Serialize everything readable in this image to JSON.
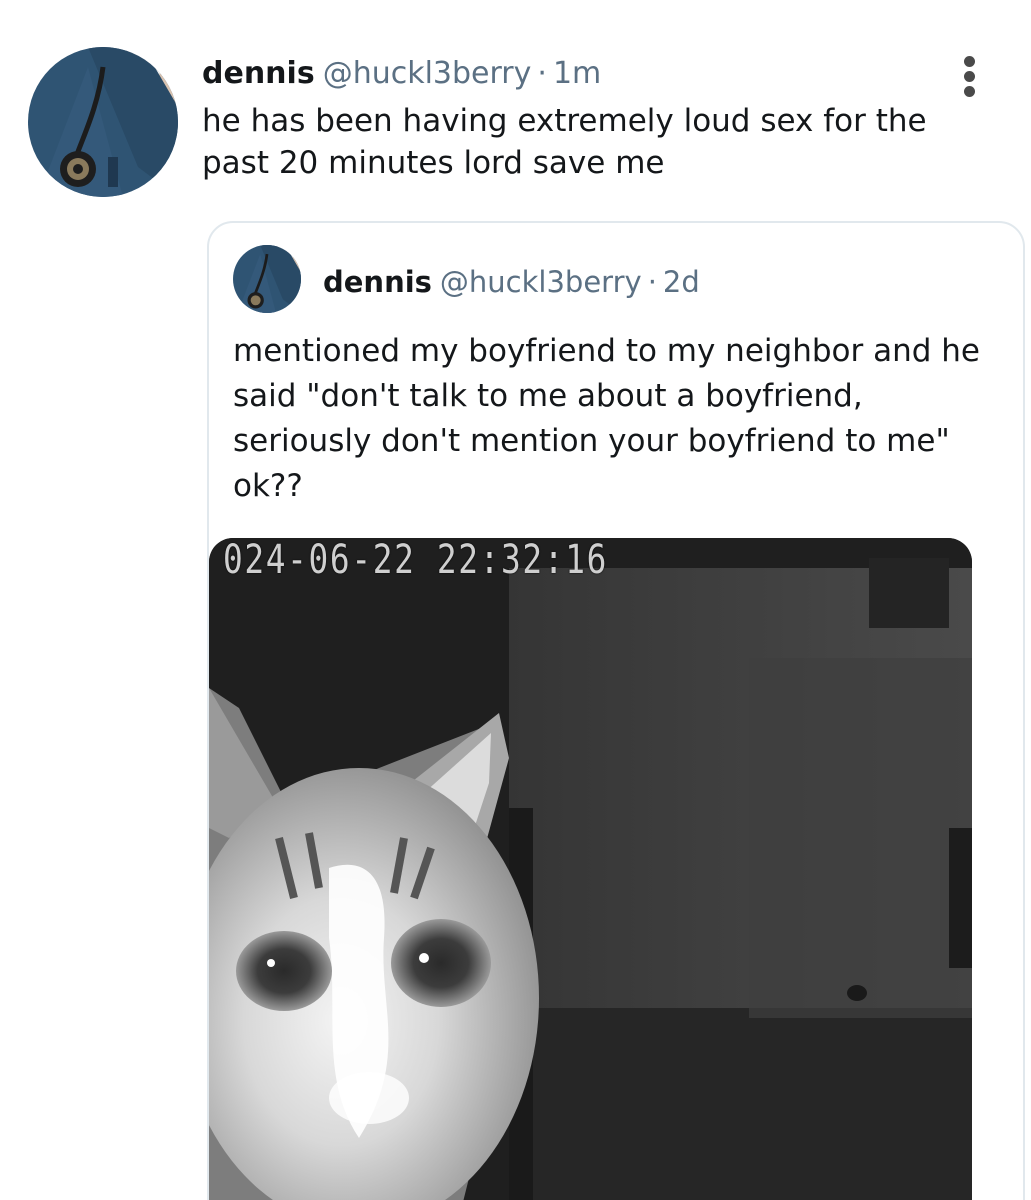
{
  "tweet": {
    "author_name": "dennis",
    "author_handle": "@huckl3berry",
    "separator": "·",
    "time": "1m",
    "text": "he has been having extremely loud sex for the past 20 minutes lord save me",
    "menu_icon": "more-vertical-icon"
  },
  "quoted_tweet": {
    "author_name": "dennis",
    "author_handle": "@huckl3berry",
    "separator": "·",
    "time": "2d",
    "text": "mentioned my boyfriend to my neighbor and he said \"don't talk to me about a boyfriend, seriously don't mention your boyfriend to me\" ok??",
    "media": {
      "overlay_timestamp": "024-06-22  22:32:16"
    }
  },
  "colors": {
    "text_primary": "#14171a",
    "text_secondary": "#5b7083",
    "card_border": "#e1e8ed",
    "avatar_scrubs": "#2f5473"
  }
}
